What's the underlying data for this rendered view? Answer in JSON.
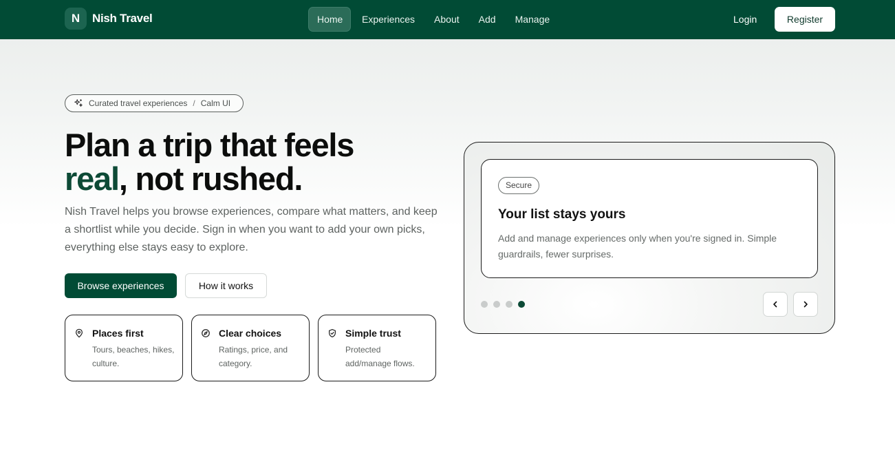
{
  "brand": {
    "logo_letter": "N",
    "name": "Nish Travel"
  },
  "nav": {
    "links": [
      {
        "label": "Home"
      },
      {
        "label": "Experiences"
      },
      {
        "label": "About"
      },
      {
        "label": "Add"
      },
      {
        "label": "Manage"
      }
    ],
    "active": "Home",
    "login_label": "Login",
    "register_label": "Register"
  },
  "hero": {
    "pill": {
      "text1": "Curated travel experiences",
      "separator": "/",
      "text2": "Calm UI",
      "icon": "sparkles-icon"
    },
    "title_line1": "Plan a trip that feels",
    "title_accent": "real",
    "title_line2_rest": ", not rushed.",
    "description": "Nish Travel helps you browse experiences, compare what matters, and keep a shortlist while you decide. Sign in when you want to add your own picks, everything else stays easy to explore.",
    "primary_button": "Browse experiences",
    "secondary_button": "How it works"
  },
  "features": [
    {
      "title": "Places first",
      "text": "Tours, beaches, hikes, culture.",
      "icon": "map-pin-icon"
    },
    {
      "title": "Clear choices",
      "text": "Ratings, price, and category.",
      "icon": "compass-icon"
    },
    {
      "title": "Simple trust",
      "text": "Protected add/manage flows.",
      "icon": "shield-check-icon"
    }
  ],
  "carousel": {
    "slide": {
      "badge": "Secure",
      "title": "Your list stays yours",
      "text": "Add and manage experiences only when you're signed in. Simple guardrails, fewer surprises."
    },
    "active_dot": 4,
    "dot_count": 4
  },
  "colors": {
    "primary": "#014b35",
    "accent_text": "#0d4a36",
    "nav_active": "#2b6c58"
  }
}
